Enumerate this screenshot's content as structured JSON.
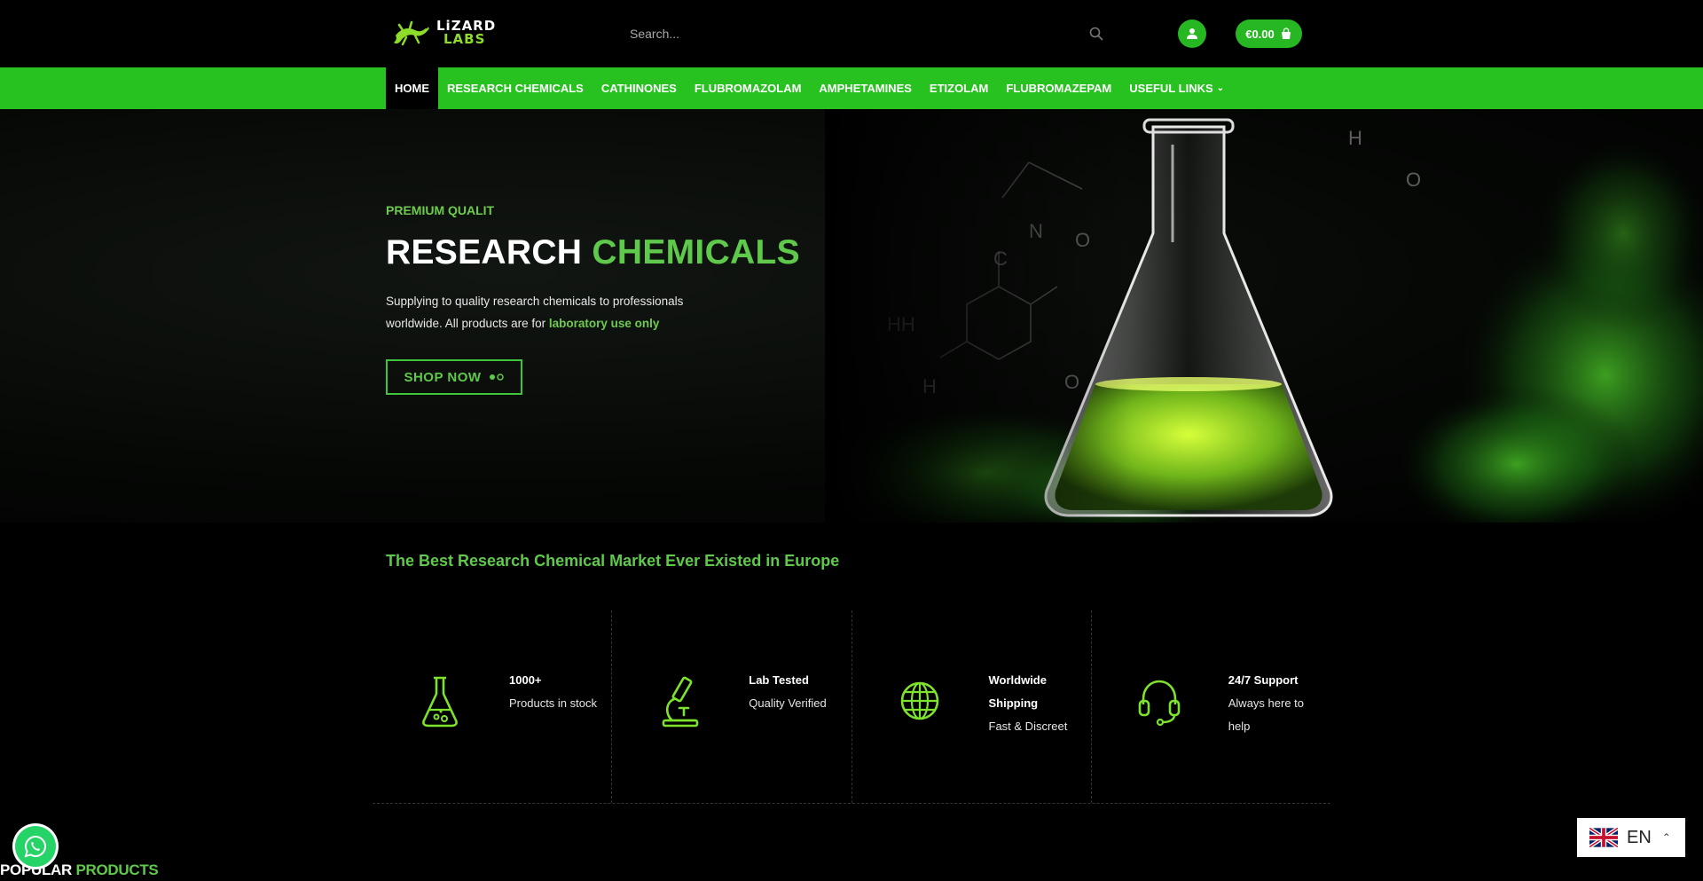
{
  "brand": {
    "line1": "LiZARD",
    "line2": "LABS"
  },
  "search": {
    "placeholder": "Search..."
  },
  "cart": {
    "total": "€0.00"
  },
  "nav": {
    "items": [
      {
        "label": "HOME",
        "active": true
      },
      {
        "label": "RESEARCH CHEMICALS"
      },
      {
        "label": "CATHINONES"
      },
      {
        "label": "FLUBROMAZOLAM"
      },
      {
        "label": "AMPHETAMINES"
      },
      {
        "label": "ETIZOLAM"
      },
      {
        "label": "FLUBROMAZEPAM"
      },
      {
        "label": "USEFUL LINKS"
      }
    ]
  },
  "hero": {
    "kicker": "PREMIUM QUALIT",
    "title_part1": "RESEARCH",
    "title_part2": "CHEMICALS",
    "desc_line1": "Supplying to quality research chemicals to professionals",
    "desc_line2": "worldwide. All products are for",
    "desc_highlight": "laboratory use only",
    "button": "SHOP NOW"
  },
  "tagline": "The Best Research Chemical Market Ever Existed in Europe",
  "features": [
    {
      "icon": "flask-icon",
      "title": "1000+",
      "subtitle": "Products in stock"
    },
    {
      "icon": "microscope-icon",
      "title": "Lab Tested",
      "subtitle": "Quality Verified"
    },
    {
      "icon": "globe-icon",
      "title": "Worldwide Shipping",
      "subtitle": "Fast & Discreet"
    },
    {
      "icon": "headset-icon",
      "title": "24/7 Support",
      "subtitle": "Always here to help"
    }
  ],
  "popular": {
    "part1": "POPULAR",
    "part2": "PRODUCTS"
  },
  "language": {
    "code": "EN"
  },
  "colors": {
    "brand_green": "#27c21f",
    "accent_green": "#5ec94a"
  }
}
